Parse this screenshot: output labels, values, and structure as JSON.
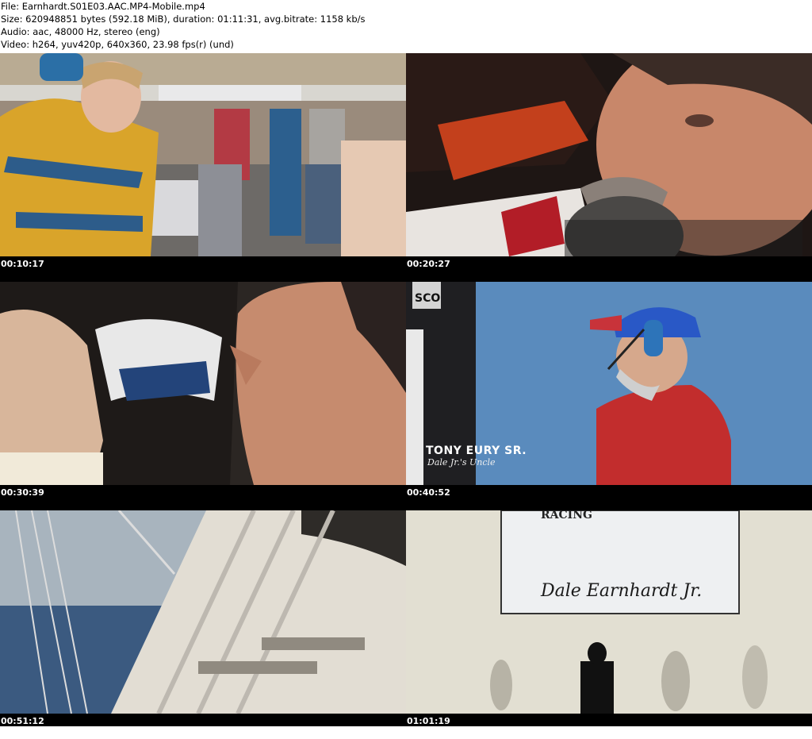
{
  "header": {
    "file_line": "File: Earnhardt.S01E03.AAC.MP4-Mobile.mp4",
    "size_line": "Size: 620948851 bytes (592.18 MiB), duration: 01:11:31, avg.bitrate: 1158 kb/s",
    "audio_line": "Audio: aac, 48000 Hz, stereo (eng)",
    "video_line": "Video: h264, yuv420p, 640x360, 23.98 fps(r) (und)"
  },
  "thumbnails": [
    {
      "timestamp": "00:10:17"
    },
    {
      "timestamp": "00:20:27"
    },
    {
      "timestamp": "00:30:39"
    },
    {
      "timestamp": "00:40:52",
      "caption_name": "TONY EURY SR.",
      "caption_sub": "Dale Jr.'s Uncle",
      "sign_text": "SCO"
    },
    {
      "timestamp": "00:51:12"
    },
    {
      "timestamp": "01:01:19",
      "banner_signature": "Dale Earnhardt Jr.",
      "banner_top": "RACING"
    }
  ],
  "colors": {
    "header_bg": "#ffffff",
    "grid_bg": "#000000",
    "timestamp_text": "#ffffff"
  }
}
